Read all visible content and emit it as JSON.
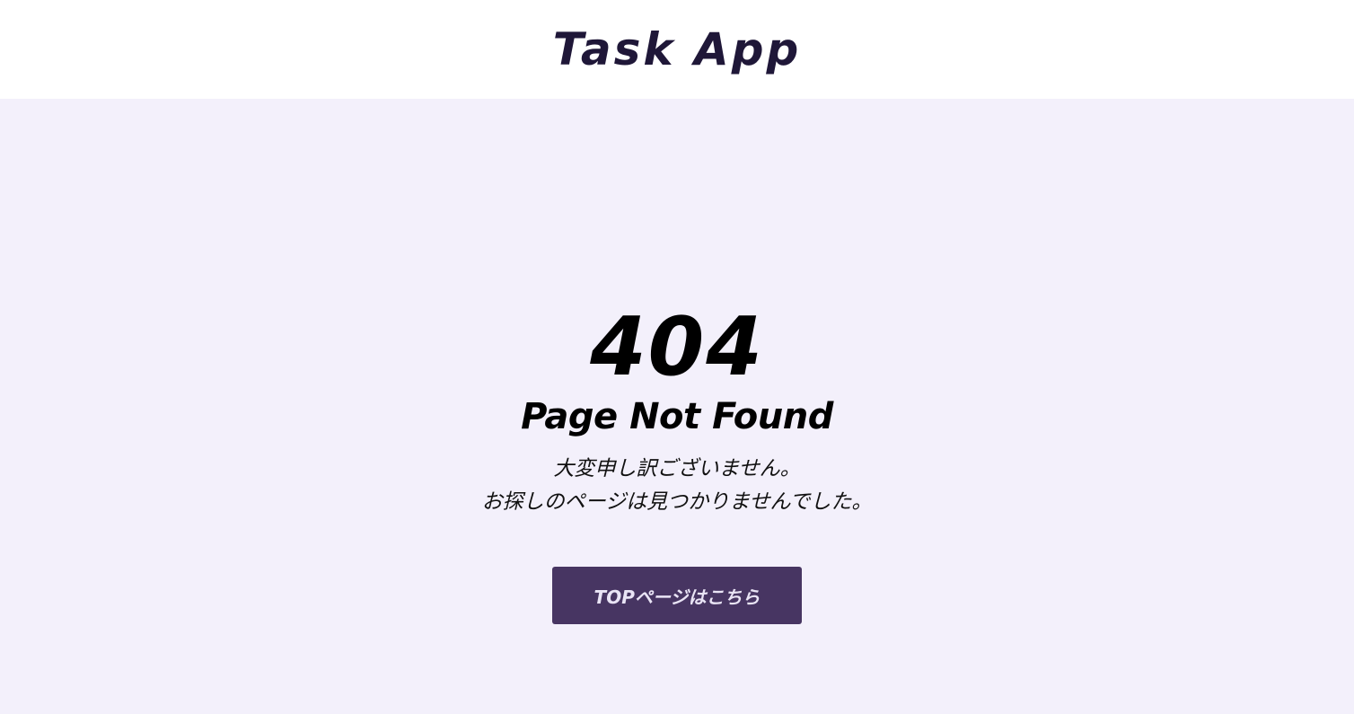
{
  "header": {
    "title": "Task App"
  },
  "error": {
    "code": "404",
    "title": "Page Not Found",
    "message_lines": [
      "大変申し訳ございません。",
      "お探しのページは見つかりませんでした。"
    ]
  },
  "actions": {
    "top_button_label": "TOPページはこちら"
  },
  "colors": {
    "header_background": "#ffffff",
    "page_background": "#f3f0fb",
    "title_color": "#1f1738",
    "button_background": "#473562",
    "button_text": "#e9e4f5"
  }
}
